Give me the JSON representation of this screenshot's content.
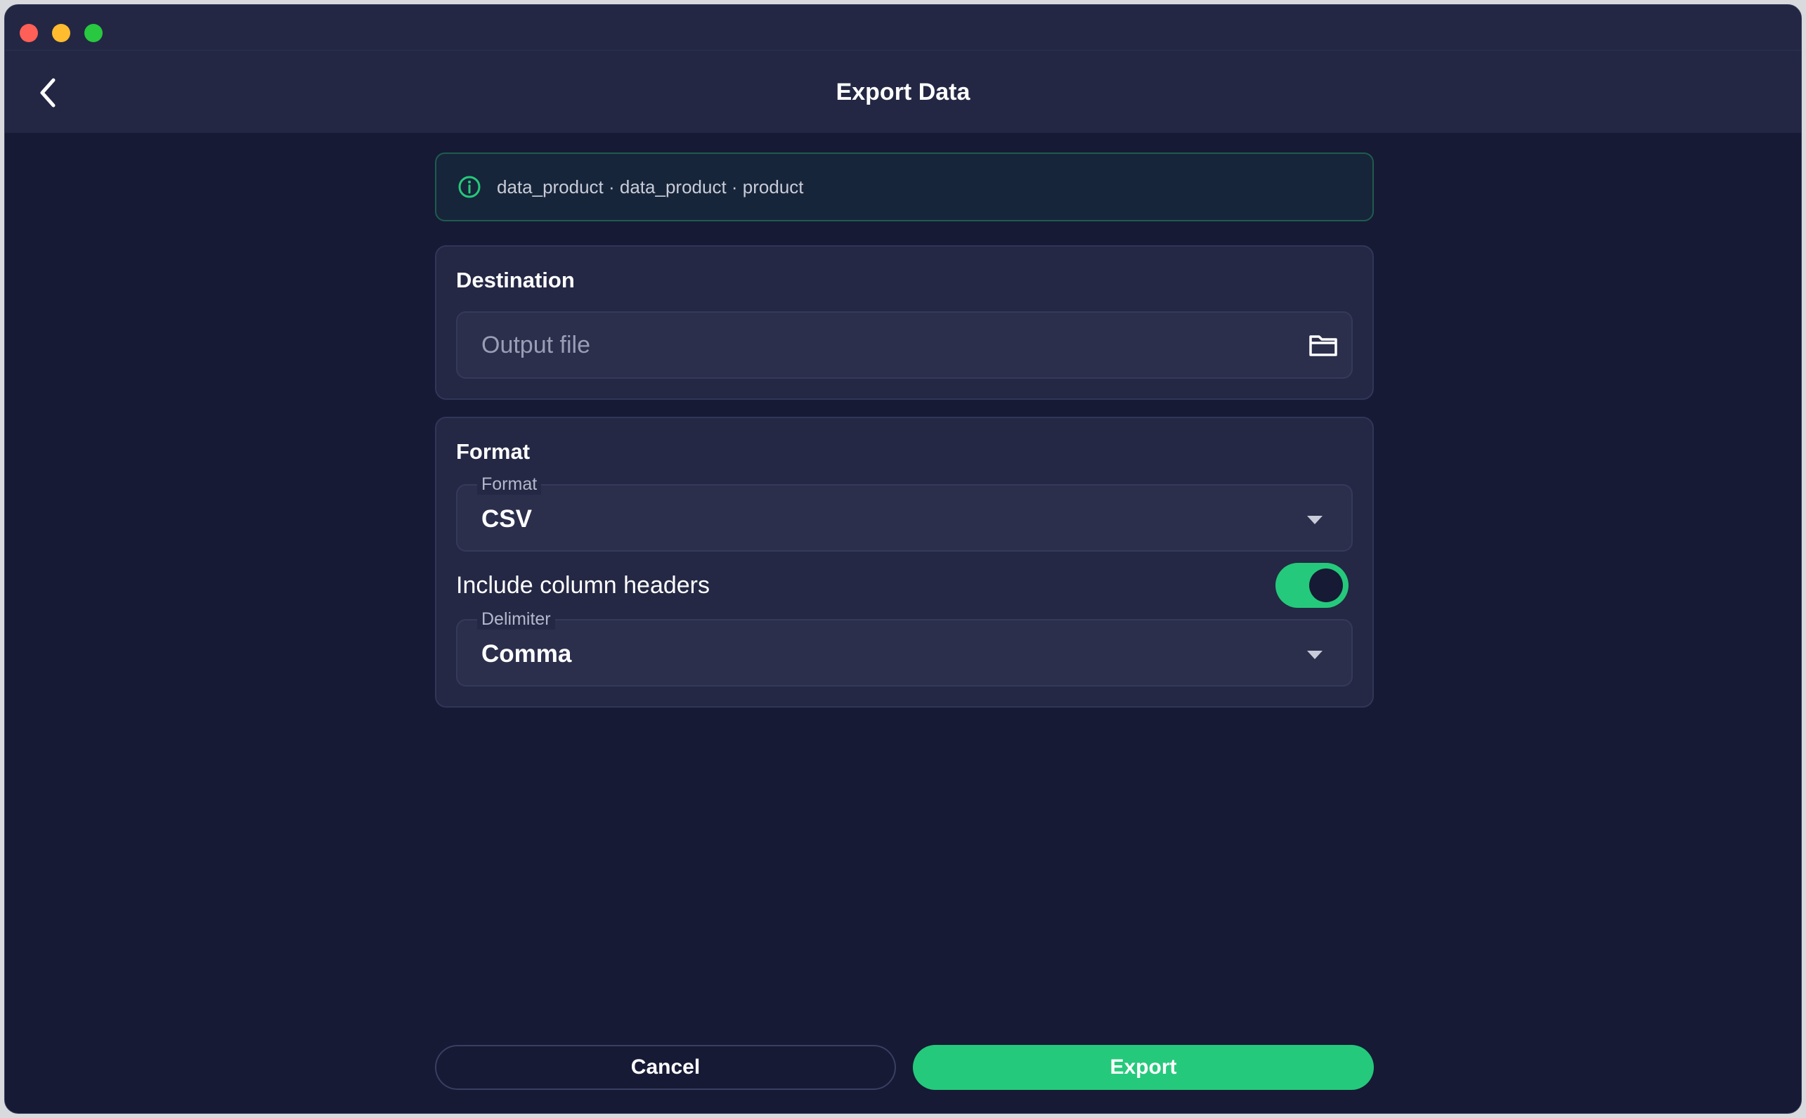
{
  "window": {
    "title": "Export Data",
    "controls": [
      "close-button",
      "minimize-button",
      "zoom-button"
    ]
  },
  "header": {
    "title": "Export Data",
    "back_icon": "chevron-left-icon"
  },
  "banner": {
    "icon": "info-icon",
    "text": "data_product · data_product · product",
    "accent_color": "#25c97b"
  },
  "destination": {
    "title": "Destination",
    "output_file": {
      "value": "",
      "placeholder": "Output file",
      "icon": "folder-icon"
    }
  },
  "format_section": {
    "title": "Format",
    "format_select": {
      "label": "Format",
      "value": "CSV"
    },
    "include_headers": {
      "label": "Include column headers",
      "enabled": true
    },
    "delimiter_select": {
      "label": "Delimiter",
      "value": "Comma"
    }
  },
  "actions": {
    "cancel_label": "Cancel",
    "export_label": "Export"
  },
  "colors": {
    "background": "#161a35",
    "card": "#242844",
    "accent": "#25c97b"
  }
}
